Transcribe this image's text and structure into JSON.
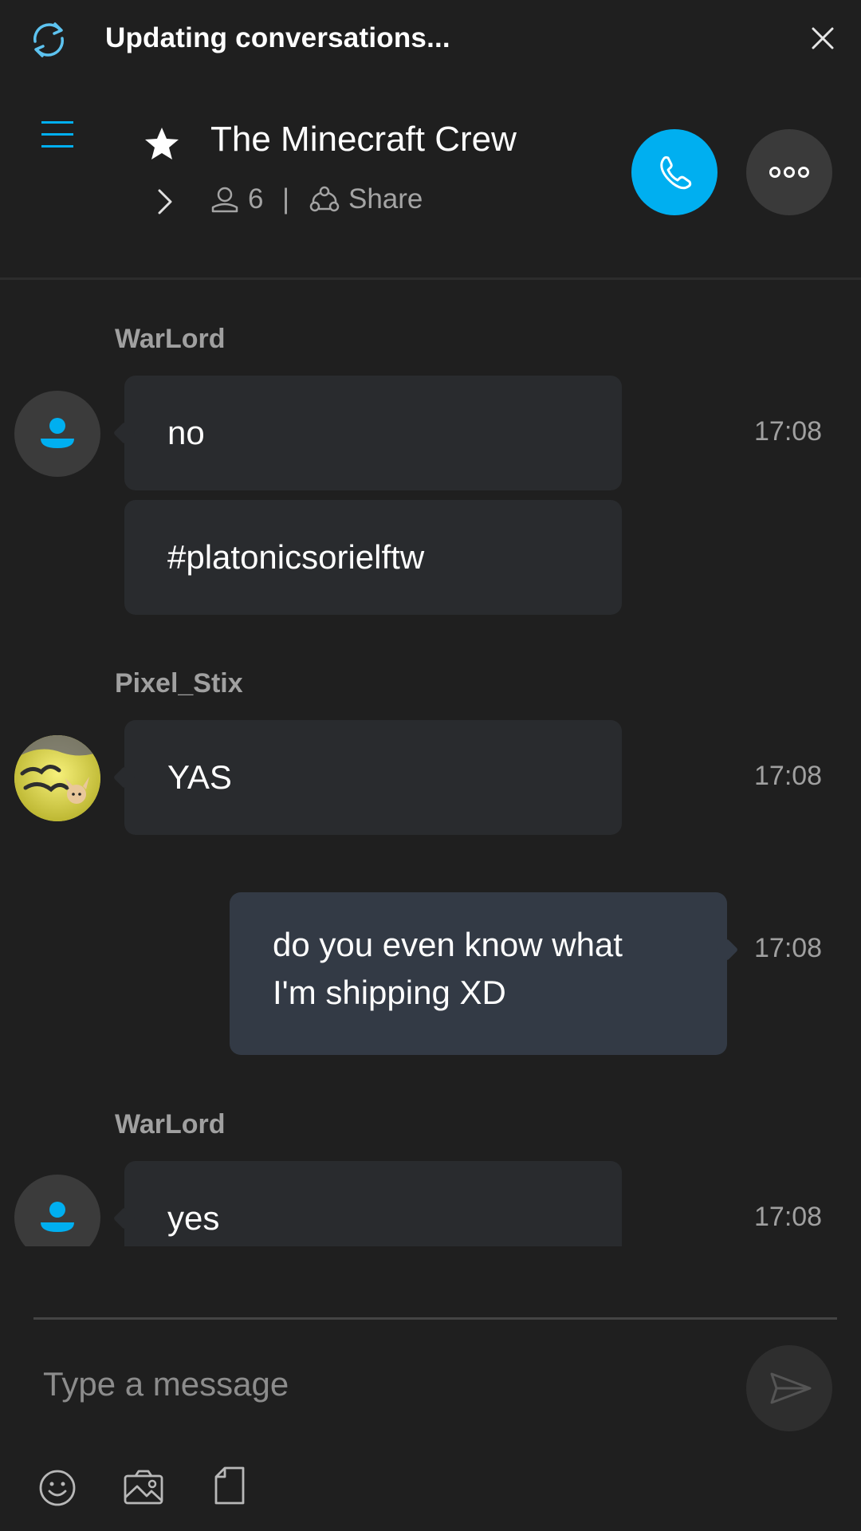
{
  "status_bar": {
    "text": "Updating conversations...",
    "sync_icon": "sync-icon",
    "close_icon": "close-icon"
  },
  "header": {
    "menu_icon": "hamburger-menu-icon",
    "favorite_icon": "star-icon",
    "title": "The Minecraft Crew",
    "members_count": "6",
    "separator": "|",
    "share_label": "Share",
    "call_icon": "phone-icon",
    "more_icon": "more-dots-icon"
  },
  "messages": [
    {
      "sender": "WarLord",
      "text": "no",
      "time": "17:08"
    },
    {
      "text": "#platonicsorielftw"
    },
    {
      "sender": "Pixel_Stix",
      "text": "YAS",
      "time": "17:08"
    },
    {
      "text_line1": "do you even know what",
      "text_line2": "I'm shipping XD",
      "time": "17:08",
      "own": true
    },
    {
      "sender": "WarLord",
      "text": "yes",
      "time": "17:08"
    }
  ],
  "composer": {
    "placeholder": "Type a message",
    "send_icon": "send-icon",
    "emoji_icon": "emoji-icon",
    "image_icon": "image-icon",
    "file_icon": "file-icon"
  },
  "colors": {
    "background": "#1f1f1f",
    "accent": "#00aff0",
    "bubble_other": "#292b2e",
    "bubble_own": "#333a45",
    "muted_text": "#a0a0a0"
  }
}
